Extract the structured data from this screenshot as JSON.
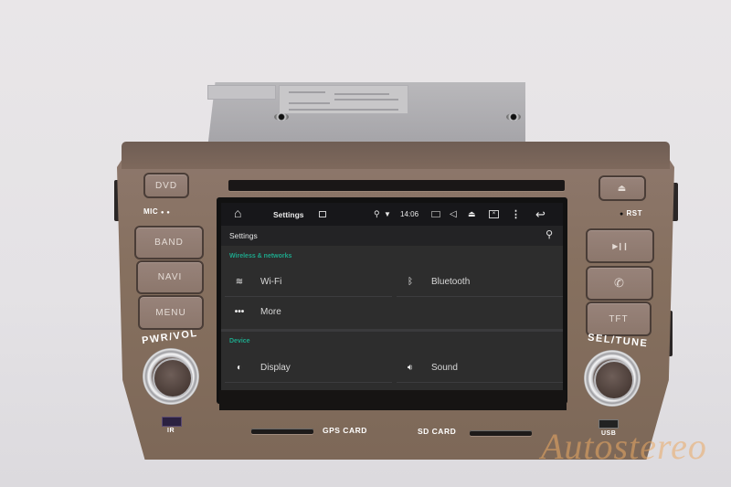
{
  "device": {
    "left_buttons": [
      "DVD",
      "BAND",
      "NAVI",
      "MENU"
    ],
    "right_buttons": {
      "eject": "⏏",
      "play_pause": "▶❙❙",
      "phone": "✆",
      "tft": "TFT"
    },
    "mic_label": "MIC",
    "rst_label": "RST",
    "knob_left_label": "PWR/VOL",
    "knob_right_label": "SEL/TUNE",
    "ir_label": "IR",
    "usb_label": "USB",
    "gps_card_label": "GPS CARD",
    "sd_card_label": "SD CARD",
    "watermark": "Autostereo"
  },
  "statusbar": {
    "title": "Settings",
    "time": "14:06"
  },
  "appbar": {
    "title": "Settings"
  },
  "sections": [
    {
      "header": "Wireless & networks",
      "items": [
        {
          "label": "Wi-Fi",
          "icon": "wifi-icon"
        },
        {
          "label": "Bluetooth",
          "icon": "bluetooth-icon"
        },
        {
          "label": "More",
          "icon": "more-dots-icon"
        }
      ]
    },
    {
      "header": "Device",
      "items": [
        {
          "label": "Display",
          "icon": "brightness-icon"
        },
        {
          "label": "Sound",
          "icon": "volume-icon"
        }
      ]
    }
  ],
  "colors": {
    "accent": "#1ea68a",
    "bezel": "#86705f",
    "screen_bg": "#2d2d2d",
    "statusbar_bg": "#17171a"
  }
}
